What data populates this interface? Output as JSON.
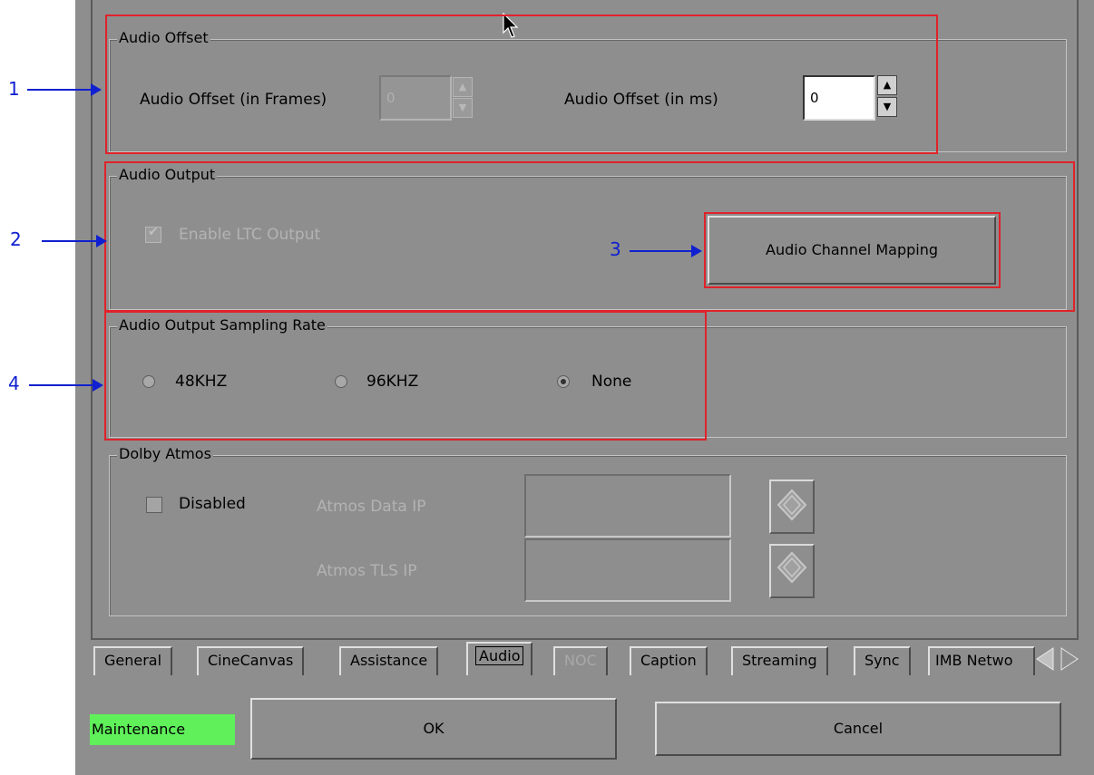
{
  "audio_offset": {
    "legend": "Audio Offset",
    "frames_label": "Audio Offset (in Frames)",
    "frames_value": "0",
    "ms_label": "Audio Offset (in ms)",
    "ms_value": "0"
  },
  "audio_output": {
    "legend": "Audio Output",
    "ltc_label": "Enable LTC Output",
    "ltc_checked": true,
    "mapping_button": "Audio Channel Mapping"
  },
  "sampling_rate": {
    "legend": "Audio Output Sampling Rate",
    "options": [
      "48KHZ",
      "96KHZ",
      "None"
    ],
    "selected": "None"
  },
  "dolby_atmos": {
    "legend": "Dolby Atmos",
    "disabled_label": "Disabled",
    "data_ip_label": "Atmos Data IP",
    "tls_ip_label": "Atmos TLS IP",
    "data_ip_value": "",
    "tls_ip_value": ""
  },
  "tabs": [
    "General",
    "CineCanvas",
    "Assistance",
    "Audio",
    "NOC",
    "Caption",
    "Streaming",
    "Sync",
    "IMB Netwo"
  ],
  "active_tab": "Audio",
  "footer": {
    "status": "Maintenance",
    "ok_label": "OK",
    "cancel_label": "Cancel"
  },
  "callouts": [
    "1",
    "2",
    "3",
    "4"
  ],
  "colors": {
    "panel_bg": "#8e8e8e",
    "annotation_red": "#e0222a",
    "annotation_blue": "#1020d0",
    "status_green": "#5ff05a"
  }
}
